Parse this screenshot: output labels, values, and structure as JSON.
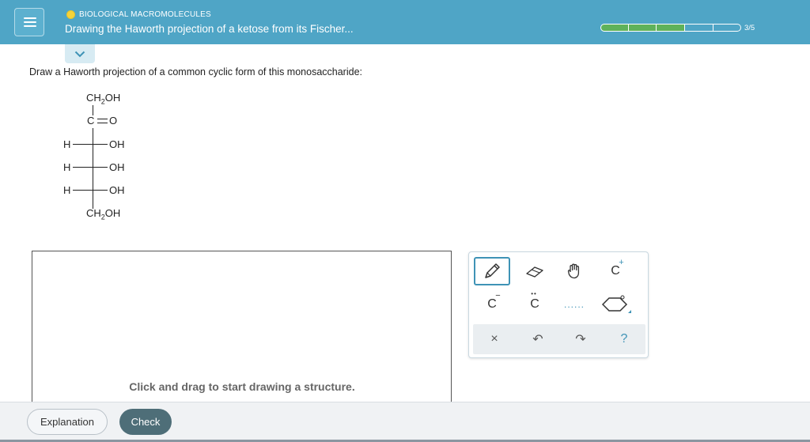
{
  "header": {
    "category": "BIOLOGICAL MACROMOLECULES",
    "title": "Drawing the Haworth projection of a ketose from its Fischer...",
    "progress": {
      "completed": 3,
      "total": 5,
      "label": "3/5"
    },
    "colors": {
      "bar": "#4fa5c6",
      "progress_fill": "#5fb25a",
      "dot": "#f5d33a"
    }
  },
  "question": {
    "prompt": "Draw a Haworth projection of a common cyclic form of this monosaccharide:"
  },
  "fischer": {
    "top_group": "CH",
    "top_sub": "2",
    "top_tail": "OH",
    "carbonyl_c": "C",
    "carbonyl_o": "O",
    "rows": [
      {
        "left": "H",
        "right": "OH"
      },
      {
        "left": "H",
        "right": "OH"
      },
      {
        "left": "H",
        "right": "OH"
      }
    ],
    "bottom_group": "CH",
    "bottom_sub": "2",
    "bottom_tail": "OH"
  },
  "canvas": {
    "hint": "Click and drag to start drawing a structure."
  },
  "toolbox": {
    "tools": [
      {
        "name": "pencil-tool",
        "icon": "pencil-icon",
        "active": true
      },
      {
        "name": "eraser-tool",
        "icon": "eraser-icon"
      },
      {
        "name": "hand-tool",
        "icon": "hand-icon"
      },
      {
        "name": "cation-tool",
        "label": "C",
        "sup": "+"
      },
      {
        "name": "anion-tool",
        "label": "C",
        "sup": "−"
      },
      {
        "name": "lone-pair-tool",
        "label": "C",
        "dots": "••"
      },
      {
        "name": "dotted-bond-tool",
        "label": "......"
      },
      {
        "name": "ring-template-tool",
        "icon": "ring-icon"
      }
    ],
    "actions": [
      {
        "name": "clear",
        "label": "×"
      },
      {
        "name": "undo",
        "label": "↶"
      },
      {
        "name": "redo",
        "label": "↷"
      },
      {
        "name": "help",
        "label": "?"
      }
    ]
  },
  "footer": {
    "explanation_label": "Explanation",
    "check_label": "Check"
  }
}
